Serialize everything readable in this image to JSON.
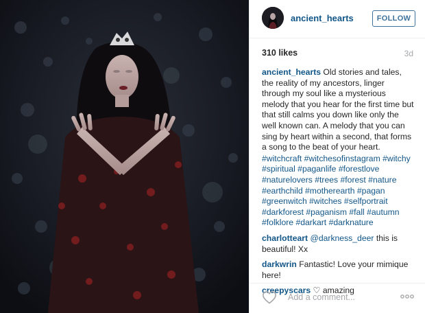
{
  "post": {
    "username": "ancient_hearts",
    "follow_label": "FOLLOW",
    "likes": "310 likes",
    "age": "3d",
    "caption": {
      "user": "ancient_hearts",
      "text": "Old stories and tales, the reality of my ancestors, linger through my soul like a mysterious melody that you hear for the first time but that still calms you down like only the well known can. A melody that you can sing by heart within a second, that forms a song to the beat of your heart.",
      "hashtags": [
        "#witchcraft",
        "#witchesofinstagram",
        "#witchy",
        "#spiritual",
        "#paganlife",
        "#forestlove",
        "#naturelovers",
        "#trees",
        "#forest",
        "#nature",
        "#earthchild",
        "#motherearth",
        "#pagan",
        "#greenwitch",
        "#witches",
        "#selfportrait",
        "#darkforest",
        "#paganism",
        "#fall",
        "#autumn",
        "#folklore",
        "#darkart",
        "#darknature"
      ]
    },
    "comments": [
      {
        "user": "charlotteart",
        "mention": "@darkness_deer",
        "text": "this is beautiful! Xx"
      },
      {
        "user": "darkwrin",
        "text": "Fantastic! Love your mimique here!"
      },
      {
        "user": "creepyscars",
        "heart": "♡",
        "text": "amazing"
      }
    ],
    "comment_placeholder": "Add a comment...",
    "icons": {
      "like": "heart-outline-icon",
      "more": "more-options-icon"
    },
    "colors": {
      "link_blue": "#125688",
      "follow_blue": "#3f729b",
      "muted_grey": "#a5a7aa",
      "text": "#262626"
    }
  }
}
